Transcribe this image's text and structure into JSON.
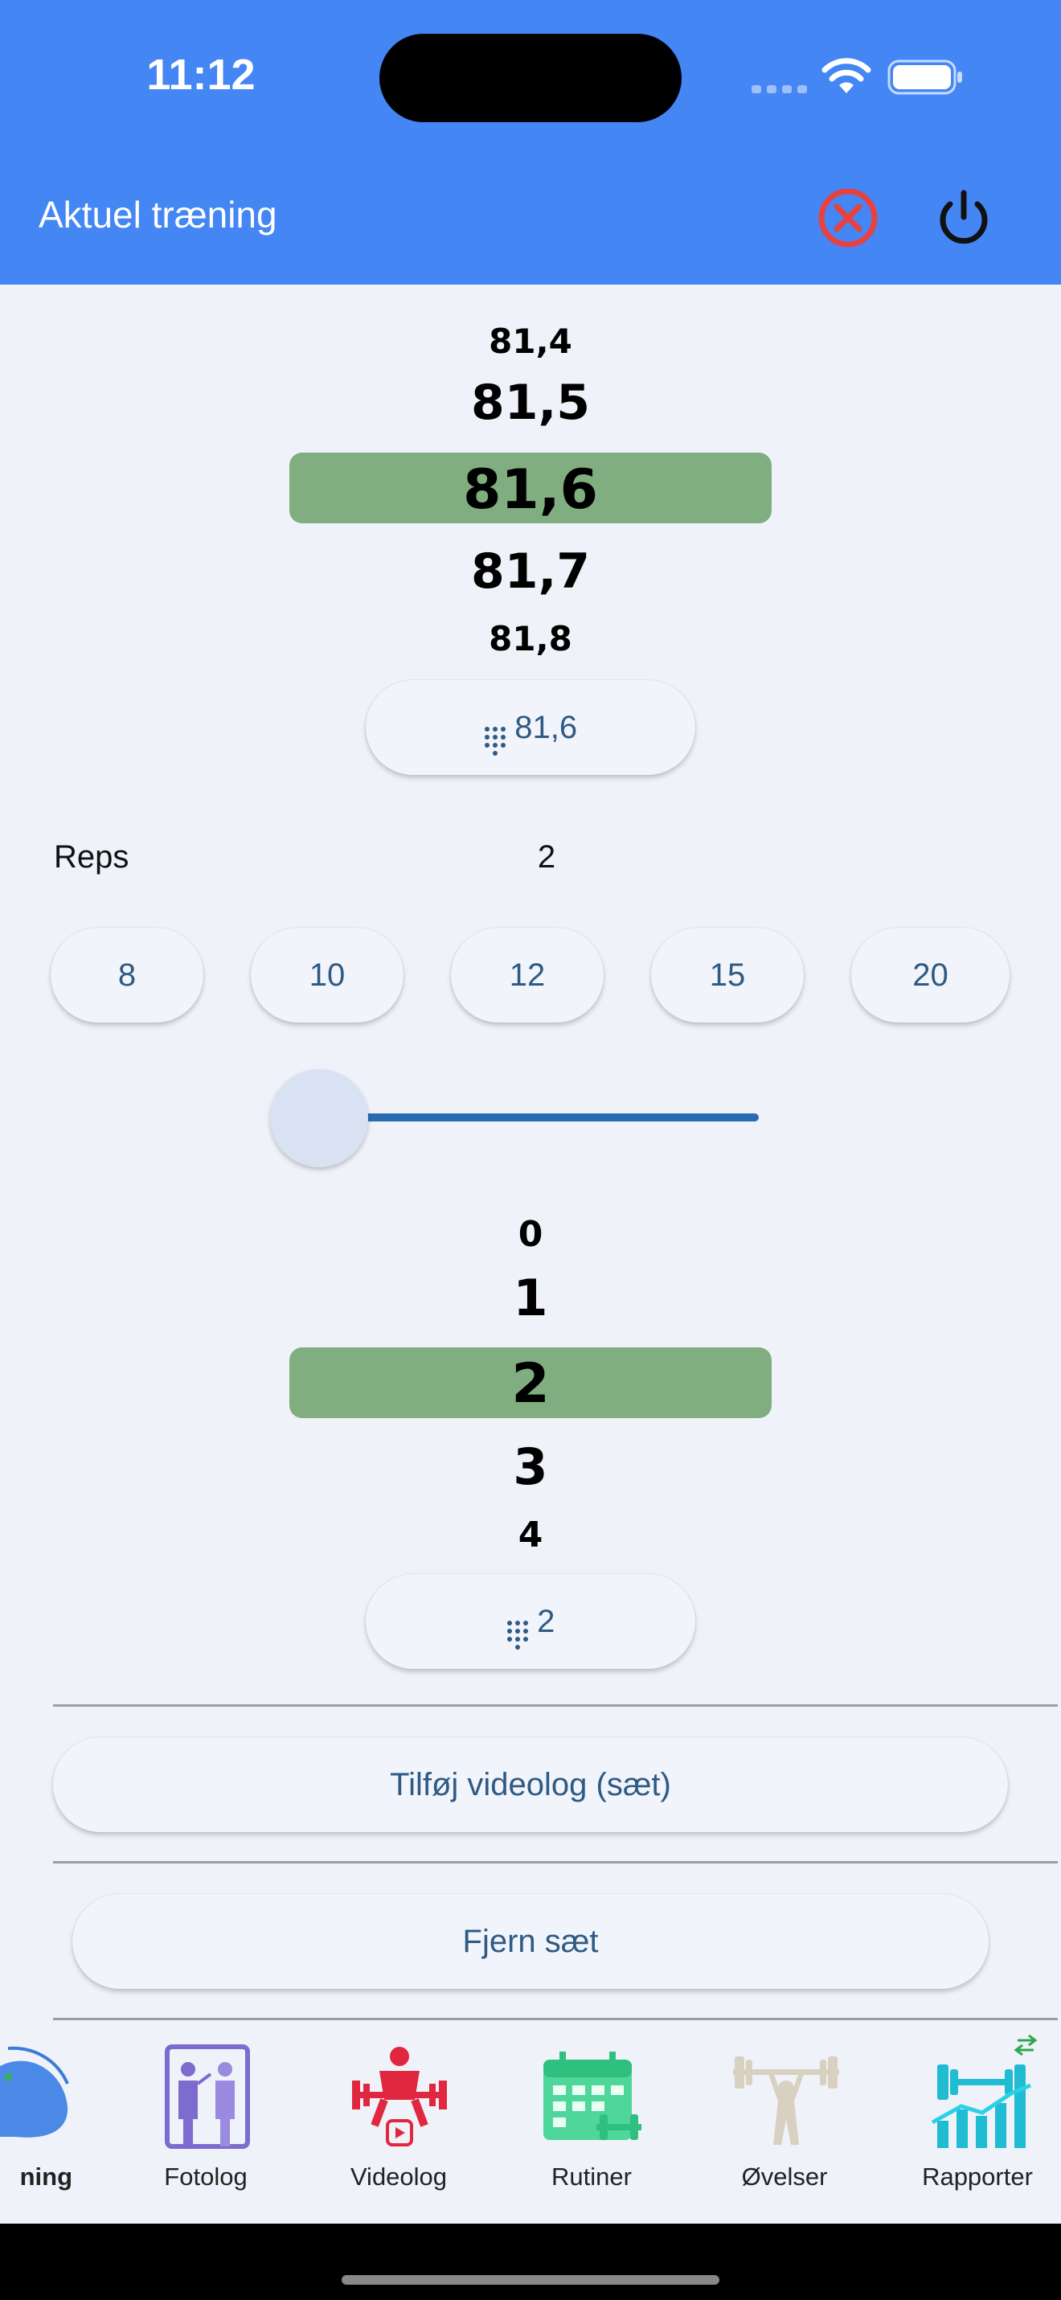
{
  "status_bar": {
    "time": "11:12"
  },
  "header": {
    "title": "Aktuel træning"
  },
  "weight_picker": {
    "values": [
      "81,4",
      "81,5",
      "81,6",
      "81,7",
      "81,8"
    ],
    "selected": "81,6",
    "keypad_label": "81,6"
  },
  "reps": {
    "label": "Reps",
    "value": "2",
    "presets": [
      "8",
      "10",
      "12",
      "15",
      "20"
    ],
    "slider_level": 0
  },
  "reps_picker": {
    "values": [
      "0",
      "1",
      "2",
      "3",
      "4"
    ],
    "selected": "2",
    "keypad_label": "2"
  },
  "actions": {
    "add_videolog": "Tilføj videolog (sæt)",
    "remove_set": "Fjern sæt"
  },
  "bottom_nav": [
    {
      "label": "ning",
      "icon": "muscle-icon"
    },
    {
      "label": "Fotolog",
      "icon": "photo-mirror-icon"
    },
    {
      "label": "Videolog",
      "icon": "weightlifter-video-icon"
    },
    {
      "label": "Rutiner",
      "icon": "calendar-dumbbell-icon"
    },
    {
      "label": "Øvelser",
      "icon": "barbell-lifter-icon"
    },
    {
      "label": "Rapporter",
      "icon": "chart-dumbbell-icon"
    }
  ],
  "colors": {
    "header": "#4486f4",
    "picker_highlight": "#80ae80",
    "pill_text": "#2f5a84",
    "slider_track": "#2a6ab3",
    "close_icon": "#e94040"
  }
}
